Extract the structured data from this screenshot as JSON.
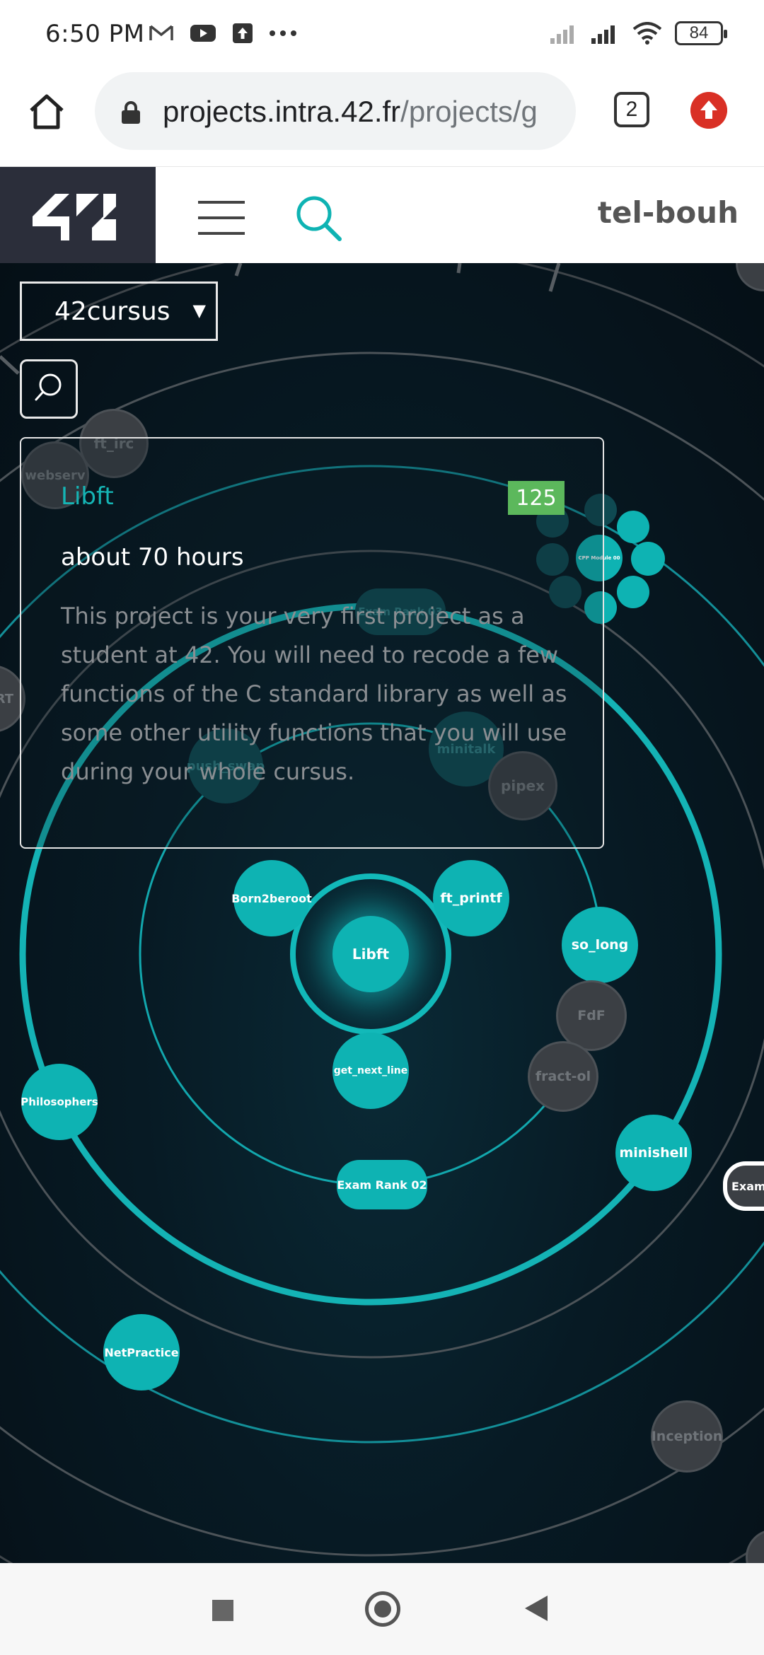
{
  "status_bar": {
    "time": "6:50 PM",
    "battery": "84",
    "left_icons": [
      "gmail-icon",
      "youtube-icon",
      "upload-icon",
      "more-dots-icon"
    ],
    "right_icons": [
      "signal-icon",
      "signal-icon",
      "wifi-icon",
      "battery-icon"
    ]
  },
  "browser": {
    "url_host": "projects.intra.42.fr",
    "url_path": "/projects/g",
    "tab_count": "2"
  },
  "header": {
    "logo_text": "42",
    "username": "tel-bouh"
  },
  "controls": {
    "cursus": "42cursus"
  },
  "card": {
    "title": "Libft",
    "badge": "125",
    "duration": "about 70 hours",
    "description": "This project is your very first project as a student at 42. You will need to recode a few functions of the C standard library as well as some other utility functions that you will use during your whole cursus."
  },
  "nodes": {
    "libft": "Libft",
    "born2beroot": "Born2beroot",
    "ft_printf": "ft_printf",
    "get_next_line": "get_next_line",
    "so_long": "so_long",
    "fdf": "FdF",
    "fract_ol": "fract-ol",
    "minishell": "minishell",
    "exam_rank_02": "Exam Rank 02",
    "exam_partial": "Exam",
    "philosophers": "Philosophers",
    "netpractice": "NetPractice",
    "inception": "Inception",
    "push_swap": "push_swap",
    "minitalk": "minitalk",
    "pipex": "pipex",
    "exam_rank_03": "Exam Rank 03",
    "ft_irc": "ft_irc",
    "webserv": "webserv",
    "rt_partial": "RT",
    "cpp_module_00": "CPP Module 00"
  },
  "colors": {
    "accent": "#0eb3b3",
    "badge": "#5cb85c",
    "header_dark": "#2b2e3a"
  }
}
